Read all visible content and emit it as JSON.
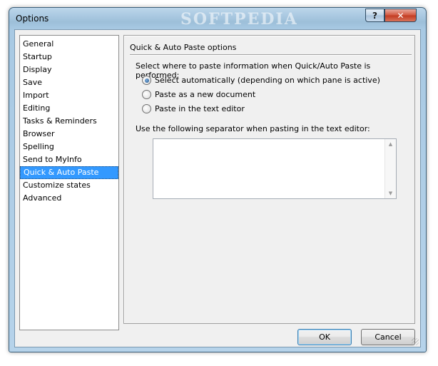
{
  "window": {
    "title": "Options",
    "watermark": "SOFTPEDIA",
    "help_glyph": "?",
    "close_glyph": "✕"
  },
  "nav": {
    "items": [
      {
        "label": "General"
      },
      {
        "label": "Startup"
      },
      {
        "label": "Display"
      },
      {
        "label": "Save"
      },
      {
        "label": "Import"
      },
      {
        "label": "Editing"
      },
      {
        "label": "Tasks & Reminders"
      },
      {
        "label": "Browser"
      },
      {
        "label": "Spelling"
      },
      {
        "label": "Send to MyInfo"
      },
      {
        "label": "Quick & Auto Paste"
      },
      {
        "label": "Customize states"
      },
      {
        "label": "Advanced"
      }
    ],
    "selected": "Quick & Auto Paste"
  },
  "panel": {
    "group_title": "Quick & Auto Paste options",
    "prompt": "Select where to paste information when Quick/Auto Paste is performed:",
    "options": [
      {
        "label": "Select automatically (depending on which pane is active)",
        "checked": true
      },
      {
        "label": "Paste as a new document",
        "checked": false
      },
      {
        "label": "Paste in the text editor",
        "checked": false
      }
    ],
    "separator_label": "Use the following separator when pasting in the text editor:",
    "separator_value": ""
  },
  "buttons": {
    "ok": "OK",
    "cancel": "Cancel"
  },
  "colors": {
    "selection": "#3399ff",
    "close_button": "#c23a20"
  }
}
